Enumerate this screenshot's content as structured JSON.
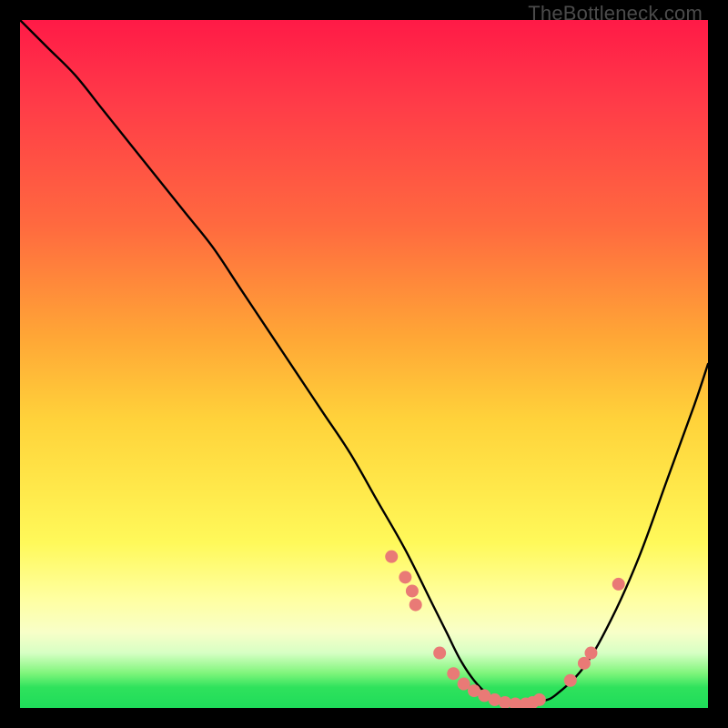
{
  "watermark": "TheBottleneck.com",
  "chart_data": {
    "type": "line",
    "title": "",
    "xlabel": "",
    "ylabel": "",
    "xlim": [
      0,
      100
    ],
    "ylim": [
      0,
      100
    ],
    "legend": false,
    "grid": false,
    "curve": {
      "name": "bottleneck-curve",
      "x": [
        0,
        4,
        8,
        12,
        16,
        20,
        24,
        28,
        32,
        36,
        40,
        44,
        48,
        52,
        56,
        60,
        62,
        64,
        66,
        68,
        70,
        72,
        74,
        76,
        78,
        82,
        86,
        90,
        94,
        98,
        100
      ],
      "y": [
        100,
        96,
        92,
        87,
        82,
        77,
        72,
        67,
        61,
        55,
        49,
        43,
        37,
        30,
        23,
        15,
        11,
        7,
        4,
        2,
        1,
        0.5,
        0.5,
        1,
        2,
        6,
        13,
        22,
        33,
        44,
        50
      ]
    },
    "points": {
      "name": "highlighted-points",
      "color": "#e97a76",
      "radius_px": 7,
      "x": [
        54,
        56,
        57,
        57.5,
        61,
        63,
        64.5,
        66,
        67.5,
        69,
        70.5,
        72,
        73.5,
        74.5,
        75.5,
        80,
        82,
        83,
        87
      ],
      "y": [
        22,
        19,
        17,
        15,
        8,
        5,
        3.5,
        2.5,
        1.8,
        1.2,
        0.8,
        0.6,
        0.6,
        0.8,
        1.2,
        4,
        6.5,
        8,
        18
      ]
    }
  }
}
